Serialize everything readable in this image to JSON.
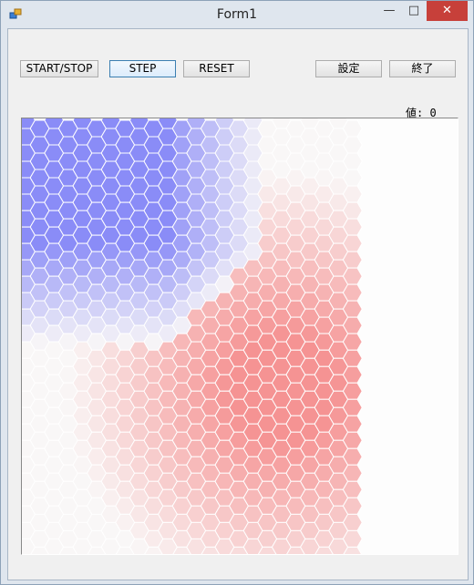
{
  "window": {
    "title": "Form1",
    "minimize_glyph": "—",
    "maximize_glyph": "□",
    "close_glyph": "✕"
  },
  "toolbar": {
    "start_stop_label": "START/STOP",
    "step_label": "STEP",
    "reset_label": "RESET",
    "settings_label": "設定",
    "exit_label": "終了"
  },
  "status": {
    "value_text": "値:  0"
  },
  "hex_grid": {
    "rows": 34,
    "cols": 16,
    "colors": {
      "cold": "#8a8cf7",
      "neutral": "#f9f7f7",
      "hot": "#f58e8e",
      "stroke": "#ffffff"
    }
  }
}
